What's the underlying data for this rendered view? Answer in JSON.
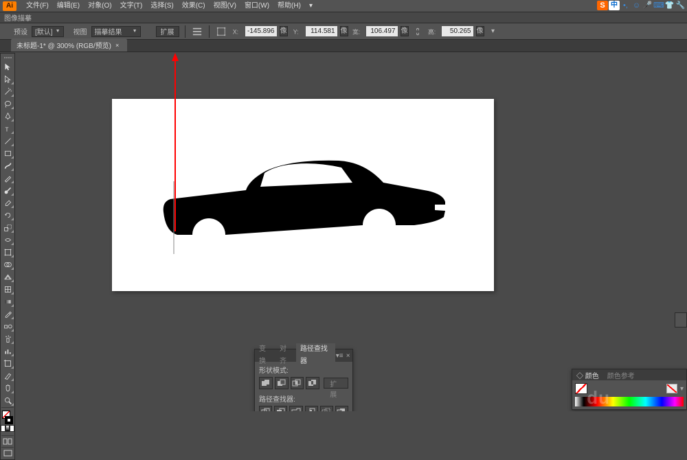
{
  "menu": {
    "file": "文件(F)",
    "edit": "编辑(E)",
    "object": "对象(O)",
    "type": "文字(T)",
    "select": "选择(S)",
    "effect": "效果(C)",
    "view": "视图(V)",
    "window": "窗口(W)",
    "help": "帮助(H)"
  },
  "ime": {
    "lang": "中"
  },
  "controlbar": {
    "label": "图像描摹"
  },
  "options": {
    "presetLabel": "预设",
    "presetValue": "[默认]",
    "viewLabel": "视图",
    "viewValue": "描摹结果",
    "expandBtn": "扩展",
    "x": "-145.896",
    "y": "114.581",
    "w": "106.497",
    "h": "50.265"
  },
  "docTab": "未标题-1* @ 300% (RGB/预览)",
  "pathfinder": {
    "tabs": {
      "transform": "变换",
      "align": "对齐",
      "pathfinder": "路径查找器"
    },
    "shapeModes": "形状模式:",
    "expand": "扩展",
    "pathfinderOps": "路径查找器:"
  },
  "rcolor": {
    "tab1": "颜色",
    "tab2": "颜色参考"
  },
  "wm": "du"
}
